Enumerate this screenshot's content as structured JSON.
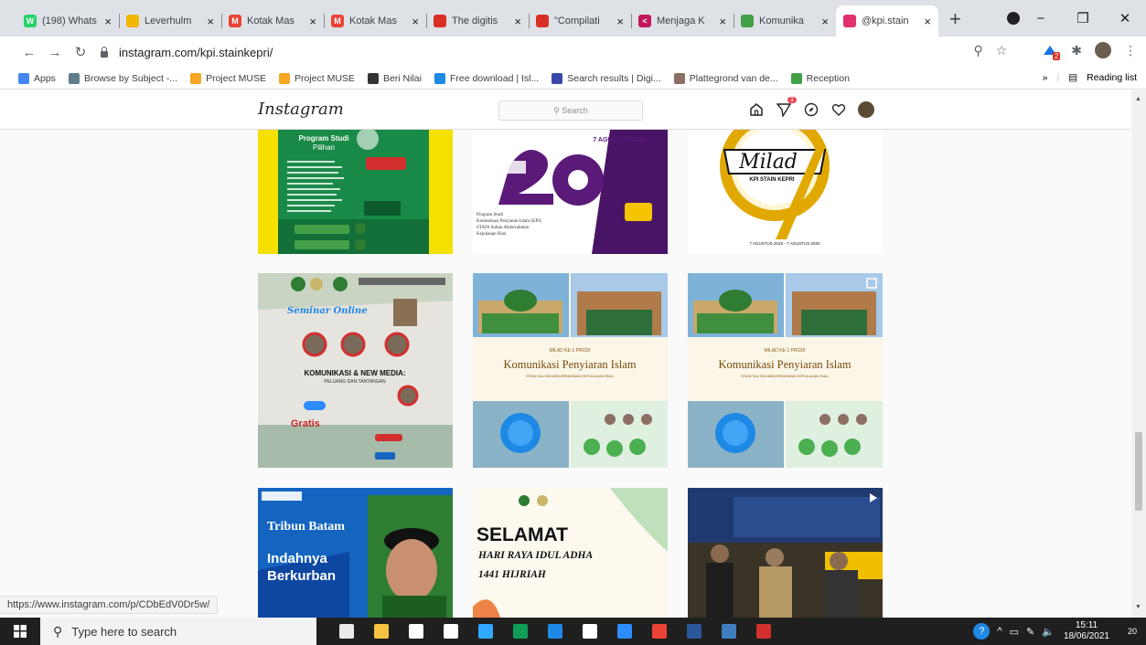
{
  "browser": {
    "tabs": [
      {
        "label": "(198) Whats",
        "fav_color": "#25d366",
        "fav_glyph": "W"
      },
      {
        "label": "Leverhulm",
        "fav_color": "#f2b705",
        "fav_glyph": ""
      },
      {
        "label": "Kotak Mas",
        "fav_color": "#ea4335",
        "fav_glyph": "M"
      },
      {
        "label": "Kotak Mas",
        "fav_color": "#ea4335",
        "fav_glyph": "M"
      },
      {
        "label": "The digitis",
        "fav_color": "#d93025",
        "fav_glyph": ""
      },
      {
        "label": "\"Compilati",
        "fav_color": "#d93025",
        "fav_glyph": ""
      },
      {
        "label": "Menjaga K",
        "fav_color": "#c2185b",
        "fav_glyph": "<"
      },
      {
        "label": "Komunika",
        "fav_color": "#43a047",
        "fav_glyph": ""
      },
      {
        "label": "@kpi.stain",
        "fav_color": "#e1306c",
        "fav_glyph": "",
        "active": true
      }
    ],
    "new_tab": "+",
    "window_controls": {
      "minimize": "−",
      "restore": "❐",
      "close": "✕"
    },
    "url": "instagram.com/kpi.stainkepri/",
    "bookmarks": [
      {
        "label": "Apps",
        "color": "#4285f4"
      },
      {
        "label": "Browse by Subject -...",
        "color": "#607d8b"
      },
      {
        "label": "Project MUSE",
        "color": "#f5a623"
      },
      {
        "label": "Project MUSE",
        "color": "#f5a623"
      },
      {
        "label": "Beri Nilai",
        "color": "#333333"
      },
      {
        "label": "Free download | Isl...",
        "color": "#1e88e5"
      },
      {
        "label": "Search results | Digi...",
        "color": "#3949ab"
      },
      {
        "label": "Plattegrond van de...",
        "color": "#8d6e63"
      },
      {
        "label": "Reception",
        "color": "#43a047"
      }
    ],
    "bookmarks_overflow": "»",
    "reading_list": "Reading list",
    "extension_badge": "2",
    "status_url": "https://www.instagram.com/p/CDbEdV0Dr5w/"
  },
  "instagram": {
    "logo": "Instagram",
    "search_placeholder": "Search",
    "notification_count": "1",
    "posts": [
      {
        "id": "prodi-pilihan",
        "lines": [
          "Program Studi",
          "Pilihan"
        ],
        "bg": "#1a8a48",
        "accent": "#f5e000"
      },
      {
        "id": "kpi-26",
        "lines": [
          "26",
          "7 AGUSTUS 2020",
          "Program Studi",
          "Komunikasi Penyiaran Islam (KPI)",
          "STAIN Sultan Abdurrahman",
          "Kepulauan Riau"
        ],
        "bg": "#ffffff",
        "accent": "#5b1a7a"
      },
      {
        "id": "milad",
        "lines": [
          "Milad",
          "KPI STAIN KEPRI",
          "7 AGUSTUS 2019 - 7 AGUSTUS 2020"
        ],
        "bg": "#ffffff",
        "accent": "#d9a400"
      },
      {
        "id": "seminar",
        "lines": [
          "Seminar Online",
          "KOMUNIKASI & NEW MEDIA:",
          "PELUANG DAN TANTANGAN",
          "Gratis"
        ],
        "bg": "#e6e4df",
        "accent": "#c62828"
      },
      {
        "id": "milad-prodi-1",
        "lines": [
          "MILAD KE-1 PRODI",
          "Komunikasi Penyiaran Islam",
          "STAIN SULTAN ABDURRAHMAN KEPULAUAN RIAU"
        ],
        "bg": "#fbf6e8",
        "accent": "#8a5a12"
      },
      {
        "id": "milad-prodi-2",
        "lines": [
          "MILAD KE-1 PRODI",
          "Komunikasi Penyiaran Islam",
          "STAIN SULTAN ABDURRAHMAN KEPULAUAN RIAU"
        ],
        "bg": "#fbf6e8",
        "accent": "#8a5a12"
      },
      {
        "id": "tribun",
        "lines": [
          "Tribun Batam",
          "Indahnya",
          "Berkurban"
        ],
        "bg": "#1565c0",
        "accent": "#ffffff"
      },
      {
        "id": "idul-adha",
        "lines": [
          "SELAMAT",
          "HARI RAYA IDUL ADHA",
          "1441 HIJRIAH"
        ],
        "bg": "#fdf9ef",
        "accent": "#1a1a1a"
      },
      {
        "id": "photo-event",
        "lines": [],
        "bg": "#2d2a24",
        "accent": "#f0c000"
      }
    ]
  },
  "taskbar": {
    "search_placeholder": "Type here to search",
    "time": "15:11",
    "date": "18/06/2021",
    "notification_count": "20",
    "apps": [
      "#e8eaed",
      "#f5c242",
      "#ffffff",
      "#ffffff",
      "#31a8ff",
      "#0f9d58",
      "#1e88e5",
      "#ffffff",
      "#2d8cff",
      "#ea4335",
      "#2b579a",
      "#3f7fbf",
      "#d32f2f"
    ]
  }
}
